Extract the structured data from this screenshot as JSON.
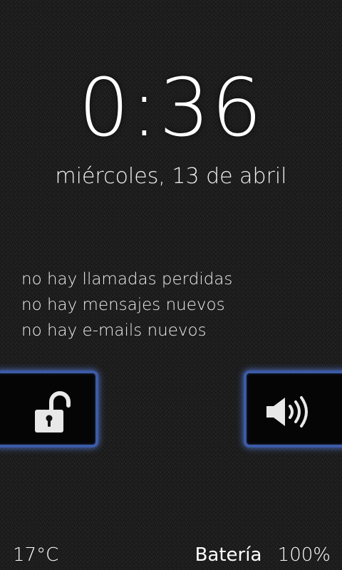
{
  "lockscreen": {
    "time": "0:36",
    "date": "miércoles, 13 de abril",
    "notifications": [
      "no hay llamadas perdidas",
      "no hay mensajes nuevos",
      "no hay e-mails nuevos"
    ]
  },
  "controls": {
    "unlock_icon": "unlock-icon",
    "sound_icon": "speaker-volume-icon",
    "accent_color": "#3c5ba8"
  },
  "status": {
    "temperature": "17°C",
    "battery_label": "Batería",
    "battery_value": "100%"
  }
}
